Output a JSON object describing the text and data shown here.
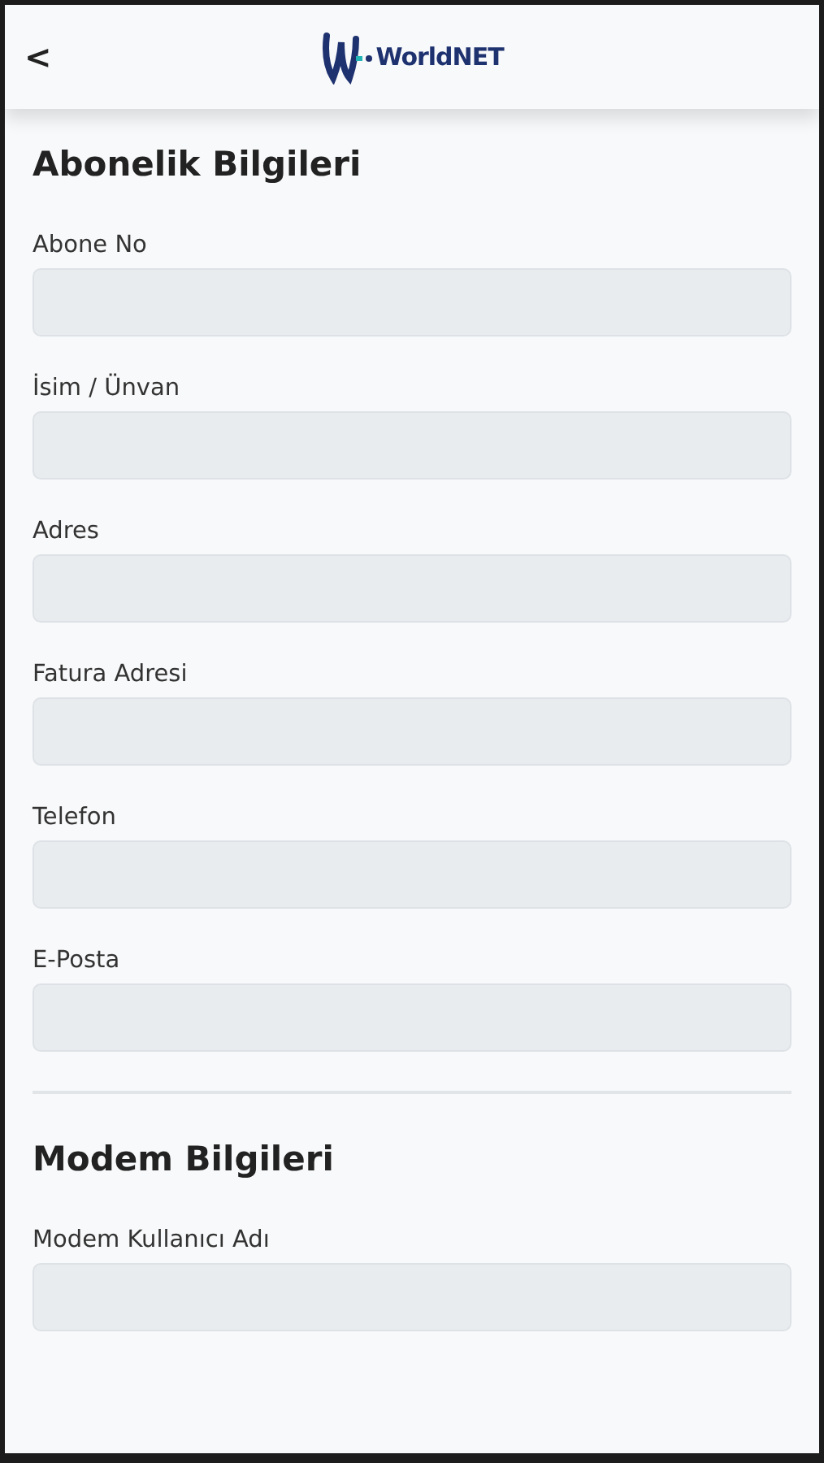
{
  "header": {
    "back": "<",
    "logo": "WorldNET"
  },
  "sections": [
    {
      "title": "Abonelik Bilgileri",
      "fields": [
        {
          "label": "Abone No"
        },
        {
          "label": "İsim / Ünvan"
        },
        {
          "label": "Adres"
        },
        {
          "label": "Fatura Adresi"
        },
        {
          "label": "Telefon"
        },
        {
          "label": "E-Posta"
        }
      ]
    },
    {
      "title": "Modem Bilgileri",
      "fields": [
        {
          "label": "Modem Kullanıcı Adı"
        }
      ]
    }
  ]
}
